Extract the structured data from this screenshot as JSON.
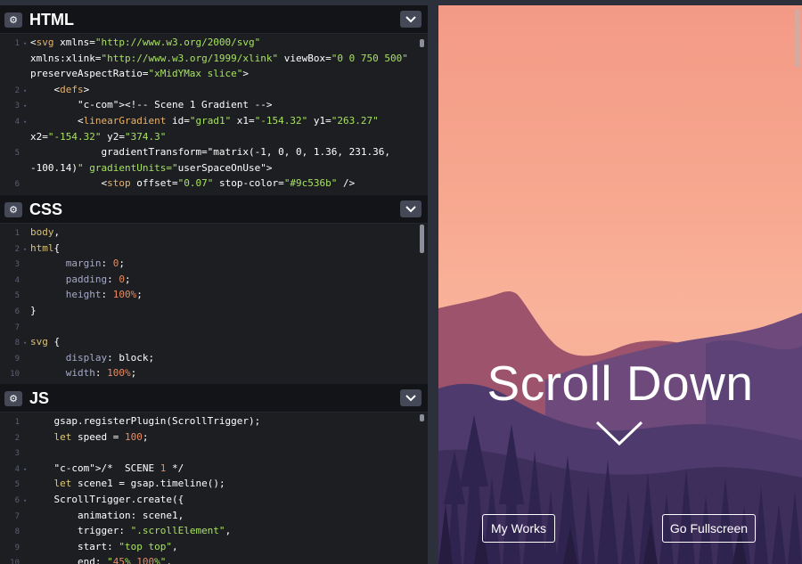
{
  "panels": {
    "html": {
      "title": "HTML",
      "lines": [
        {
          "n": "1",
          "fold": "▾",
          "text": "<svg xmlns=\"http://www.w3.org/2000/svg\""
        },
        {
          "n": "",
          "fold": "",
          "text": "xmlns:xlink=\"http://www.w3.org/1999/xlink\" viewBox=\"0 0 750 500\""
        },
        {
          "n": "",
          "fold": "",
          "text": "preserveAspectRatio=\"xMidYMax slice\">"
        },
        {
          "n": "2",
          "fold": "▾",
          "text": "    <defs>"
        },
        {
          "n": "3",
          "fold": "▾",
          "text": "        <!-- Scene 1 Gradient -->"
        },
        {
          "n": "4",
          "fold": "▾",
          "text": "        <linearGradient id=\"grad1\" x1=\"-154.32\" y1=\"263.27\""
        },
        {
          "n": "",
          "fold": "",
          "text": "x2=\"-154.32\" y2=\"374.3\""
        },
        {
          "n": "5",
          "fold": "",
          "text": "            gradientTransform=\"matrix(-1, 0, 0, 1.36, 231.36,"
        },
        {
          "n": "",
          "fold": "",
          "text": "-100.14)\" gradientUnits=\"userSpaceOnUse\">"
        },
        {
          "n": "6",
          "fold": "",
          "text": "            <stop offset=\"0.07\" stop-color=\"#9c536b\" />"
        }
      ]
    },
    "css": {
      "title": "CSS",
      "lines": [
        {
          "n": "1",
          "fold": "",
          "text": "body,"
        },
        {
          "n": "2",
          "fold": "▾",
          "text": "html{"
        },
        {
          "n": "3",
          "fold": "",
          "text": "      margin: 0;"
        },
        {
          "n": "4",
          "fold": "",
          "text": "      padding: 0;"
        },
        {
          "n": "5",
          "fold": "",
          "text": "      height: 100%;"
        },
        {
          "n": "6",
          "fold": "",
          "text": "}"
        },
        {
          "n": "7",
          "fold": "",
          "text": ""
        },
        {
          "n": "8",
          "fold": "▾",
          "text": "svg {"
        },
        {
          "n": "9",
          "fold": "",
          "text": "      display: block;"
        },
        {
          "n": "10",
          "fold": "",
          "text": "      width: 100%;"
        }
      ]
    },
    "js": {
      "title": "JS",
      "lines": [
        {
          "n": "1",
          "fold": "",
          "text": "    gsap.registerPlugin(ScrollTrigger);"
        },
        {
          "n": "2",
          "fold": "",
          "text": "    let speed = 100;"
        },
        {
          "n": "3",
          "fold": "",
          "text": ""
        },
        {
          "n": "4",
          "fold": "▾",
          "text": "    /*  SCENE 1 */"
        },
        {
          "n": "5",
          "fold": "",
          "text": "    let scene1 = gsap.timeline();"
        },
        {
          "n": "6",
          "fold": "▾",
          "text": "    ScrollTrigger.create({"
        },
        {
          "n": "7",
          "fold": "",
          "text": "        animation: scene1,"
        },
        {
          "n": "8",
          "fold": "",
          "text": "        trigger: \".scrollElement\","
        },
        {
          "n": "9",
          "fold": "",
          "text": "        start: \"top top\","
        },
        {
          "n": "10",
          "fold": "",
          "text": "        end: \"45% 100%\","
        }
      ]
    }
  },
  "preview": {
    "title": "Scroll Down",
    "buttons": {
      "works": "My Works",
      "fullscreen": "Go Fullscreen"
    }
  },
  "colors": {
    "sky_top": "#f39a86",
    "sky_bottom": "#f9b39a",
    "mountain_far": "#9c536b",
    "mountain_mid": "#5e4576",
    "mountain_near": "#3c2d5a",
    "trees": "#2a2044"
  },
  "icons": {
    "gear": "gear-icon",
    "collapse": "chevron-down-icon",
    "scroll_hint": "chevron-down-icon"
  }
}
